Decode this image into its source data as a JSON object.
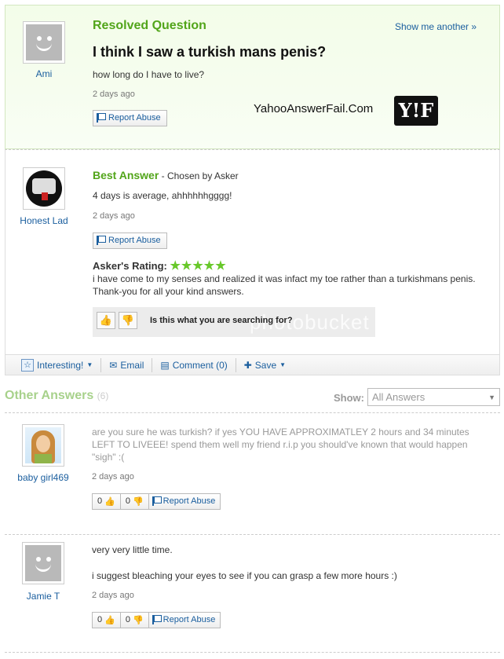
{
  "question": {
    "status": "Resolved Question",
    "show_another": "Show me another »",
    "title": "I think I saw a turkish mans penis?",
    "body": "how long do I have to live?",
    "time": "2 days ago",
    "report": "Report Abuse",
    "asker": "Ami"
  },
  "watermark": {
    "site": "YahooAnswerFail.Com",
    "logo": "Y!F"
  },
  "best_answer": {
    "label": "Best Answer",
    "chosen_by": " - Chosen by Asker",
    "text": "4 days is average, ahhhhhhgggg!",
    "time": "2 days ago",
    "report": "Report Abuse",
    "author": "Honest Lad",
    "rating_label": "Asker's Rating:",
    "rating_stars": "★★★★★",
    "rating_comment": "i have come to my senses and realized it was infact my toe rather than a turkishmans penis. Thank-you for all your kind answers.",
    "search_prompt": "Is this what you are searching for?",
    "photobucket": "photobucket"
  },
  "actions": {
    "interesting": "Interesting!",
    "email": "Email",
    "comment": "Comment (0)",
    "save": "Save"
  },
  "other": {
    "title": "Other Answers",
    "count": "(6)",
    "show_label": "Show:",
    "show_value": "All Answers"
  },
  "answers": [
    {
      "author": "baby girl469",
      "text": "are you sure he was turkish? if yes YOU HAVE APPROXIMATLEY 2 hours and 34 minutes LEFT TO LIVEEE! spend them well my friend r.i.p you should've known that would happen \"sigh\" :(",
      "time": "2 days ago",
      "up": "0",
      "down": "0",
      "report": "Report Abuse"
    },
    {
      "author": "Jamie T",
      "text1": "very very little time.",
      "text2": "i suggest bleaching your eyes to see if you can grasp a few more hours :)",
      "time": "2 days ago",
      "up": "0",
      "down": "0",
      "report": "Report Abuse"
    }
  ],
  "icons": {
    "thumb_up": "👍",
    "thumb_down": "👎",
    "star": "☆",
    "caret": "▼",
    "email": "✉",
    "comment": "▤",
    "plus": "✚"
  }
}
